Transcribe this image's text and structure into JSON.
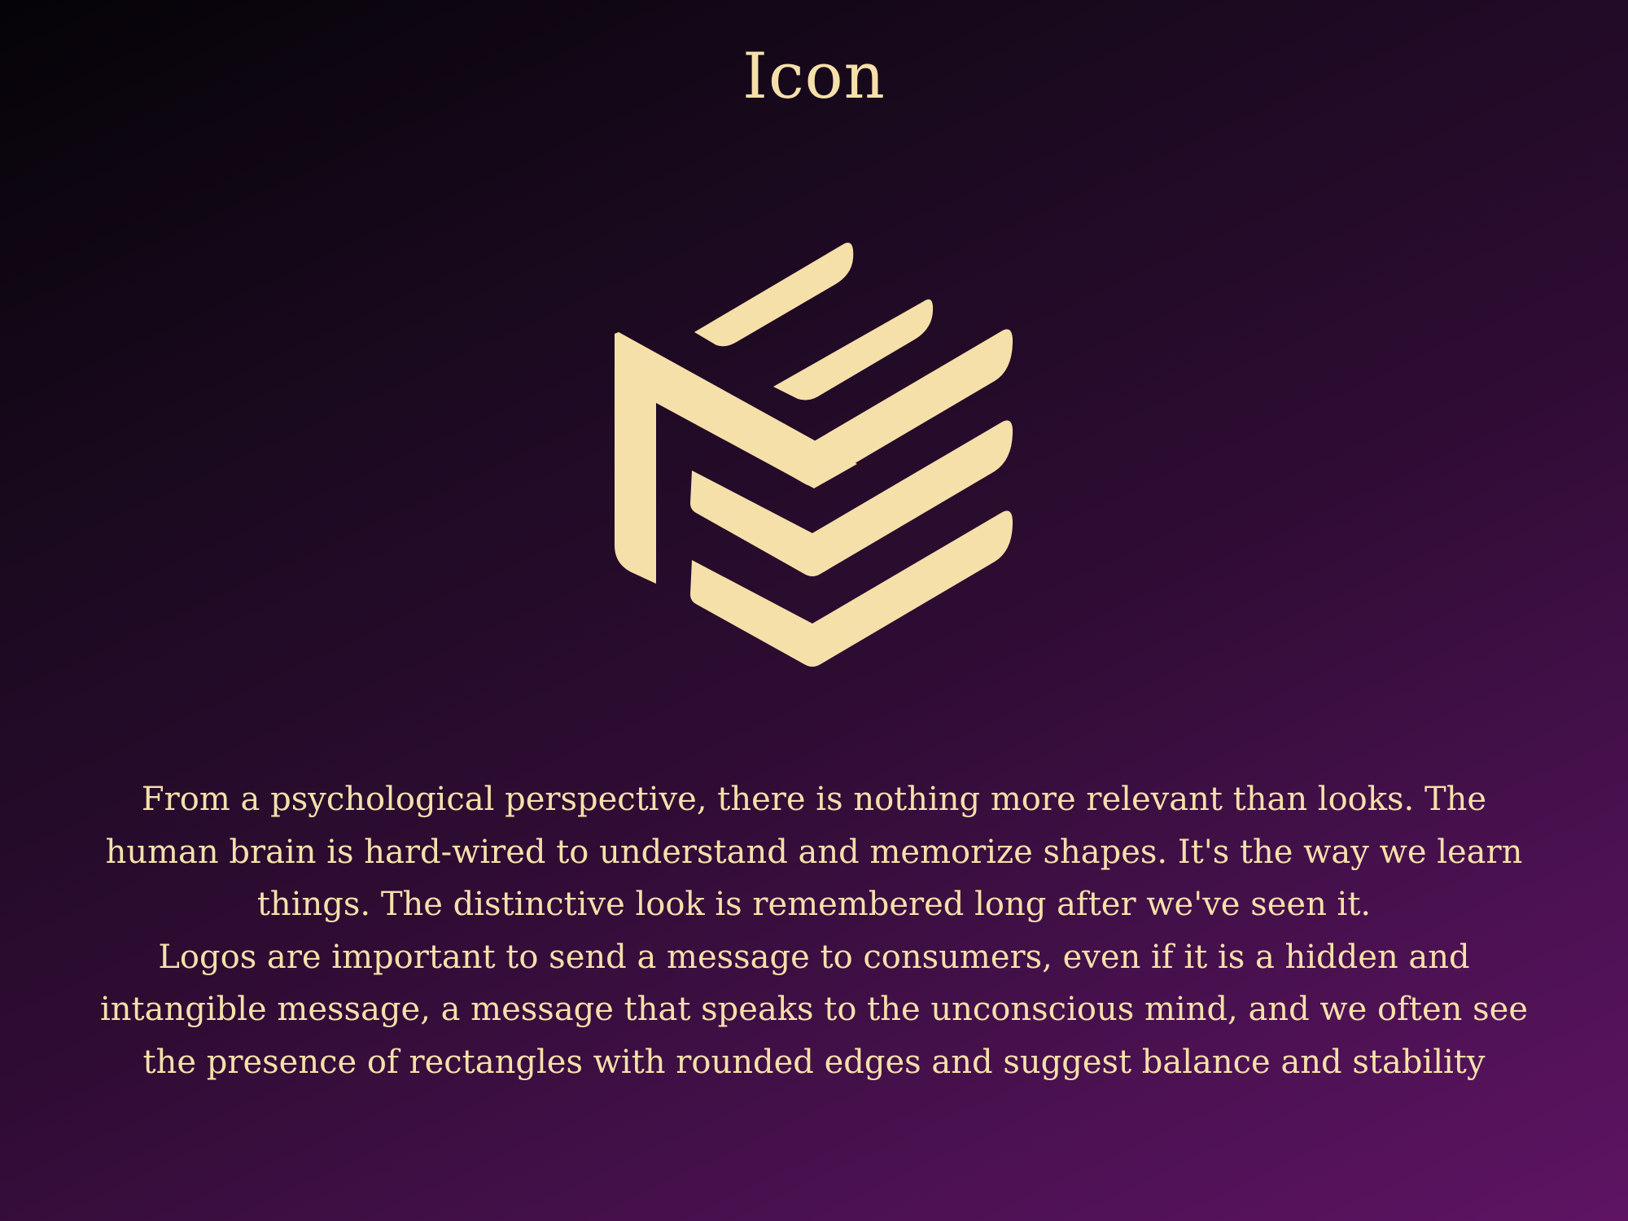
{
  "page": {
    "title": "Icon",
    "paragraphs": [
      "From a psychological perspective, there is nothing more relevant than looks. The human brain is hard-wired to understand and memorize shapes. It's the way we learn things. The distinctive look is remembered long after we've seen it.",
      "Logos are important to send a message to consumers, even if it is a hidden and intangible message, a message that speaks to the unconscious mind, and we often see the presence of rectangles with rounded edges and suggest balance and stability"
    ]
  },
  "logo": {
    "icon": "stacked-chevron-cube-logo",
    "color": "#f6e0aa"
  },
  "colors": {
    "text": "#f6e0aa",
    "background_start": "#050307",
    "background_end": "#5e1463"
  }
}
